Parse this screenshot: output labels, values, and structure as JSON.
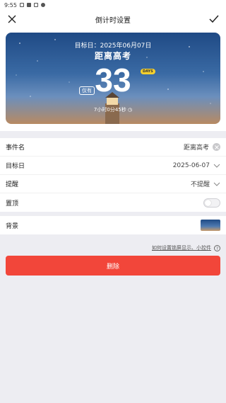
{
  "status_bar": {
    "time": "9:55"
  },
  "header": {
    "title": "倒计时设置"
  },
  "card": {
    "target_date_text": "目标日：2025年06月07日",
    "event_title": "距离高考",
    "prefix": "仅有",
    "days": "33",
    "days_unit": "DAYS",
    "countdown_text": "7小时0分45秒"
  },
  "settings": {
    "event_name": {
      "label": "事件名",
      "value": "距离高考"
    },
    "target_date": {
      "label": "目标日",
      "value": "2025-06-07"
    },
    "reminder": {
      "label": "提醒",
      "value": "不提醒"
    },
    "pin_top": {
      "label": "置顶",
      "enabled": false
    }
  },
  "background": {
    "label": "背景"
  },
  "help": {
    "link_text": "如何设置锁屏显示、小控件",
    "icon_text": "?"
  },
  "delete_button": {
    "label": "删除"
  },
  "colors": {
    "accent": "#f2463a",
    "badge": "#f5d02e"
  }
}
